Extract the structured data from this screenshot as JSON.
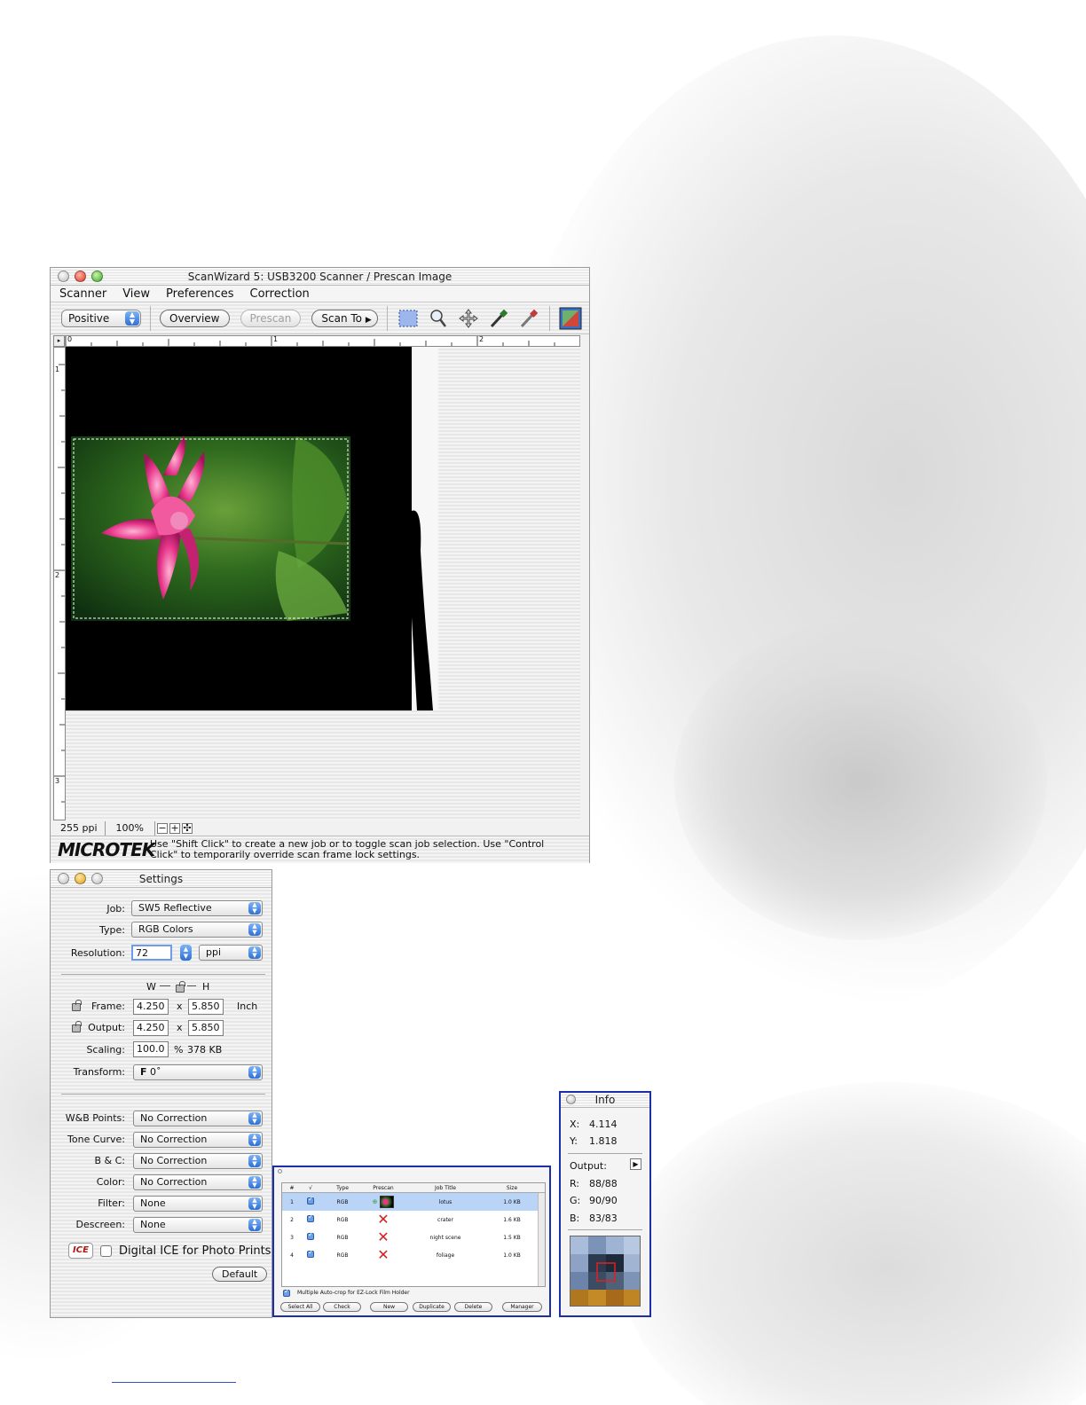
{
  "main_window": {
    "title": "ScanWizard 5: USB3200 Scanner / Prescan Image",
    "menu": [
      "Scanner",
      "View",
      "Preferences",
      "Correction"
    ],
    "toolbar": {
      "mode_popup": "Positive",
      "overview_button": "Overview",
      "prescan_button": "Prescan",
      "scan_to_button": "Scan To"
    },
    "ruler_h_labels": [
      "0",
      "1",
      "2"
    ],
    "ruler_v_labels": [
      "1",
      "2",
      "3"
    ],
    "status": {
      "resolution": "255 ppi",
      "zoom": "100%"
    },
    "footer": {
      "logo": "MICROTEK",
      "hint": "Use \"Shift Click\" to create a new job or to toggle scan job selection. Use \"Control Click\" to temporarily override scan frame lock settings."
    }
  },
  "settings": {
    "title": "Settings",
    "job_label": "Job:",
    "job_value": "SW5 Reflective",
    "type_label": "Type:",
    "type_value": "RGB Colors",
    "resolution_label": "Resolution:",
    "resolution_value": "72",
    "resolution_unit": "ppi",
    "w_label": "W",
    "h_label": "H",
    "frame_label": "Frame:",
    "frame_w": "4.250",
    "frame_h": "5.850",
    "frame_unit": "Inch",
    "times": "x",
    "output_label": "Output:",
    "output_w": "4.250",
    "output_h": "5.850",
    "scaling_label": "Scaling:",
    "scaling_value": "100.0",
    "percent": "%",
    "file_size": "378 KB",
    "transform_label": "Transform:",
    "transform_value": "0˚",
    "wb_label": "W&B Points:",
    "wb_value": "No Correction",
    "tone_label": "Tone Curve:",
    "tone_value": "No Correction",
    "bc_label": "B & C:",
    "bc_value": "No Correction",
    "color_label": "Color:",
    "color_value": "No Correction",
    "filter_label": "Filter:",
    "filter_value": "None",
    "descreen_label": "Descreen:",
    "descreen_value": "None",
    "ice_badge": "ICE",
    "ice_label": "Digital ICE for Photo Prints",
    "default_button": "Default"
  },
  "job_list": {
    "columns": [
      "#",
      "√",
      "Type",
      "Prescan",
      "Job Title",
      "Size"
    ],
    "rows": [
      {
        "num": "1",
        "type": "RGB",
        "title": "lotus",
        "size": "1.0 KB",
        "selected": true,
        "prescan": "thumb"
      },
      {
        "num": "2",
        "type": "RGB",
        "title": "crater",
        "size": "1.6 KB",
        "selected": false,
        "prescan": "x"
      },
      {
        "num": "3",
        "type": "RGB",
        "title": "night scene",
        "size": "1.5 KB",
        "selected": false,
        "prescan": "x"
      },
      {
        "num": "4",
        "type": "RGB",
        "title": "foliage",
        "size": "1.0 KB",
        "selected": false,
        "prescan": "x"
      }
    ],
    "autocrop_label": "Multiple Auto-crop for EZ-Lock Film Holder",
    "buttons": [
      "Select All",
      "Check",
      "New",
      "Duplicate",
      "Delete",
      "Manager"
    ]
  },
  "info": {
    "title": "Info",
    "x_label": "X:",
    "x_value": "4.114",
    "y_label": "Y:",
    "y_value": "1.818",
    "output_label": "Output:",
    "r_label": "R:",
    "r_value": "88/88",
    "g_label": "G:",
    "g_value": "90/90",
    "b_label": "B:",
    "b_value": "83/83"
  },
  "colors": {
    "selection_border": "#1c2fa8",
    "popup_accent": "#2f6fd6",
    "selected_row": "#b9d4f6"
  }
}
